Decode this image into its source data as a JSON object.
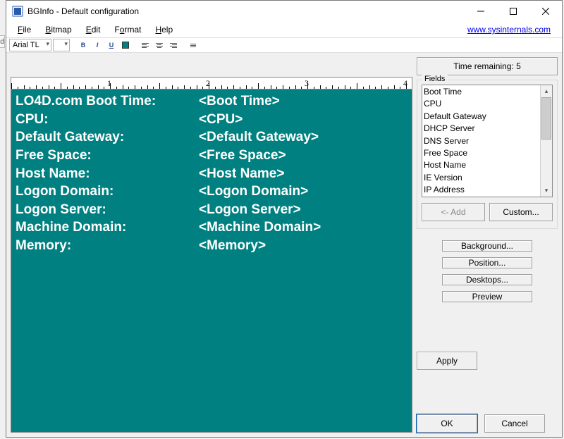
{
  "window": {
    "title": "BGInfo - Default configuration"
  },
  "menu": {
    "file": "File",
    "bitmap": "Bitmap",
    "edit": "Edit",
    "format": "Format",
    "help": "Help",
    "link": "www.sysinternals.com"
  },
  "toolbar": {
    "font_name": "Arial TL"
  },
  "ruler": {
    "labels": [
      "1",
      "2",
      "3",
      "4"
    ]
  },
  "editor": {
    "rows": [
      {
        "label": "LO4D.com Boot Time:",
        "value": "<Boot Time>"
      },
      {
        "label": "CPU:",
        "value": "<CPU>"
      },
      {
        "label": "Default Gateway:",
        "value": "<Default Gateway>"
      },
      {
        "label": "Free Space:",
        "value": "<Free Space>"
      },
      {
        "label": "Host Name:",
        "value": "<Host Name>"
      },
      {
        "label": "Logon Domain:",
        "value": "<Logon Domain>"
      },
      {
        "label": "Logon Server:",
        "value": "<Logon Server>"
      },
      {
        "label": "Machine Domain:",
        "value": "<Machine Domain>"
      },
      {
        "label": "Memory:",
        "value": "<Memory>"
      }
    ]
  },
  "right": {
    "time_remaining": "Time remaining: 5",
    "fields_legend": "Fields",
    "fields_items": [
      "Boot Time",
      "CPU",
      "Default Gateway",
      "DHCP Server",
      "DNS Server",
      "Free Space",
      "Host Name",
      "IE Version",
      "IP Address"
    ],
    "add": "<- Add",
    "custom": "Custom...",
    "background": "Background...",
    "position": "Position...",
    "desktops": "Desktops...",
    "preview": "Preview",
    "apply": "Apply",
    "ok": "OK",
    "cancel": "Cancel"
  }
}
